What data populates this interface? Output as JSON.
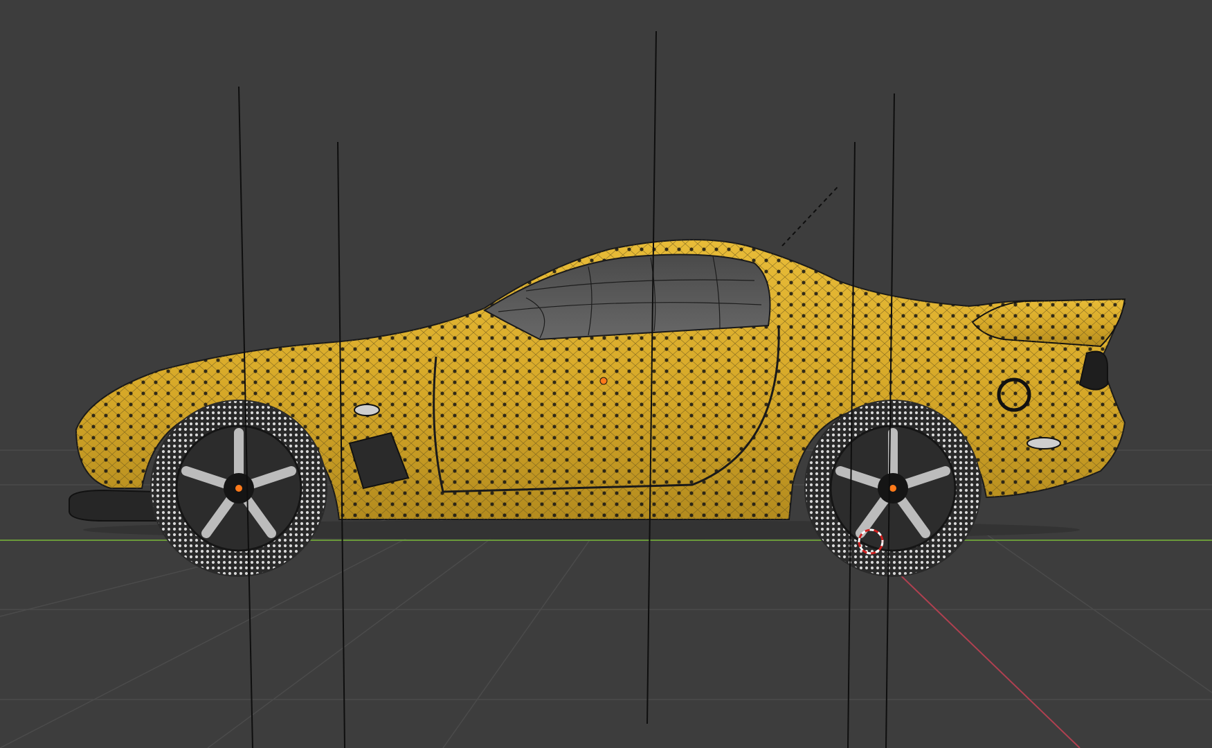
{
  "viewport": {
    "mode": "edit-mode",
    "view": "side-orthographic",
    "background_color": "#3d3d3d",
    "object": "car-mesh",
    "mesh_color": "#d8a928",
    "wireframe_color": "#111111",
    "selected_vertex_color": "#ff7a1a",
    "x_axis_color": "#b04050",
    "y_axis_color": "#6a9a3a",
    "grid_line_color": "#4a4a4a",
    "cursor_3d": "3d-cursor-icon"
  }
}
